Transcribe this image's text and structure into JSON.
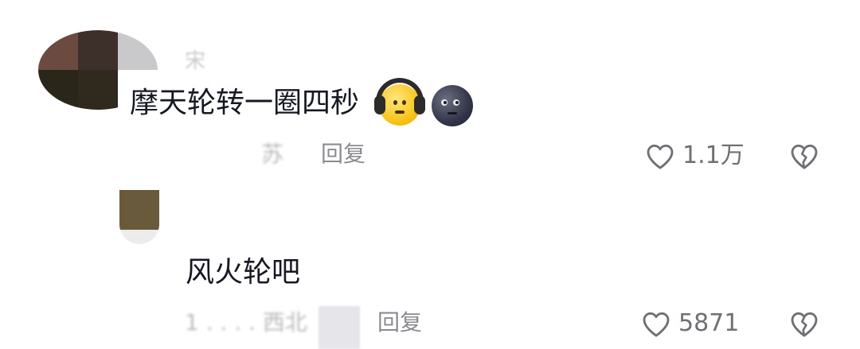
{
  "comments": [
    {
      "username_fragment": "宋",
      "text": "摩天轮转一圈四秒",
      "emojis": [
        "headphone-face-emoji",
        "new-moon-face-emoji"
      ],
      "meta_fragment": "苏",
      "reply_label": "回复",
      "like_count": "1.1万"
    },
    {
      "text": "风火轮吧",
      "meta_fragment": "1 . . . . 西北",
      "reply_label": "回复",
      "like_count": "5871"
    }
  ],
  "icons": {
    "like": "heart-outline-icon",
    "dislike": "broken-heart-icon"
  },
  "colors": {
    "text": "#161823",
    "meta": "#a7a8ac",
    "icon": "#6f7075"
  }
}
